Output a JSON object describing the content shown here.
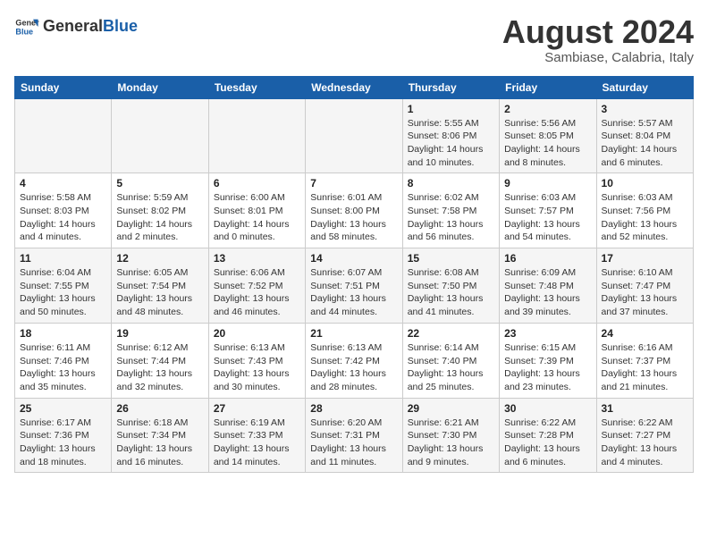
{
  "header": {
    "logo_general": "General",
    "logo_blue": "Blue",
    "month_year": "August 2024",
    "location": "Sambiase, Calabria, Italy"
  },
  "weekdays": [
    "Sunday",
    "Monday",
    "Tuesday",
    "Wednesday",
    "Thursday",
    "Friday",
    "Saturday"
  ],
  "weeks": [
    [
      {
        "day": "",
        "info": ""
      },
      {
        "day": "",
        "info": ""
      },
      {
        "day": "",
        "info": ""
      },
      {
        "day": "",
        "info": ""
      },
      {
        "day": "1",
        "info": "Sunrise: 5:55 AM\nSunset: 8:06 PM\nDaylight: 14 hours\nand 10 minutes."
      },
      {
        "day": "2",
        "info": "Sunrise: 5:56 AM\nSunset: 8:05 PM\nDaylight: 14 hours\nand 8 minutes."
      },
      {
        "day": "3",
        "info": "Sunrise: 5:57 AM\nSunset: 8:04 PM\nDaylight: 14 hours\nand 6 minutes."
      }
    ],
    [
      {
        "day": "4",
        "info": "Sunrise: 5:58 AM\nSunset: 8:03 PM\nDaylight: 14 hours\nand 4 minutes."
      },
      {
        "day": "5",
        "info": "Sunrise: 5:59 AM\nSunset: 8:02 PM\nDaylight: 14 hours\nand 2 minutes."
      },
      {
        "day": "6",
        "info": "Sunrise: 6:00 AM\nSunset: 8:01 PM\nDaylight: 14 hours\nand 0 minutes."
      },
      {
        "day": "7",
        "info": "Sunrise: 6:01 AM\nSunset: 8:00 PM\nDaylight: 13 hours\nand 58 minutes."
      },
      {
        "day": "8",
        "info": "Sunrise: 6:02 AM\nSunset: 7:58 PM\nDaylight: 13 hours\nand 56 minutes."
      },
      {
        "day": "9",
        "info": "Sunrise: 6:03 AM\nSunset: 7:57 PM\nDaylight: 13 hours\nand 54 minutes."
      },
      {
        "day": "10",
        "info": "Sunrise: 6:03 AM\nSunset: 7:56 PM\nDaylight: 13 hours\nand 52 minutes."
      }
    ],
    [
      {
        "day": "11",
        "info": "Sunrise: 6:04 AM\nSunset: 7:55 PM\nDaylight: 13 hours\nand 50 minutes."
      },
      {
        "day": "12",
        "info": "Sunrise: 6:05 AM\nSunset: 7:54 PM\nDaylight: 13 hours\nand 48 minutes."
      },
      {
        "day": "13",
        "info": "Sunrise: 6:06 AM\nSunset: 7:52 PM\nDaylight: 13 hours\nand 46 minutes."
      },
      {
        "day": "14",
        "info": "Sunrise: 6:07 AM\nSunset: 7:51 PM\nDaylight: 13 hours\nand 44 minutes."
      },
      {
        "day": "15",
        "info": "Sunrise: 6:08 AM\nSunset: 7:50 PM\nDaylight: 13 hours\nand 41 minutes."
      },
      {
        "day": "16",
        "info": "Sunrise: 6:09 AM\nSunset: 7:48 PM\nDaylight: 13 hours\nand 39 minutes."
      },
      {
        "day": "17",
        "info": "Sunrise: 6:10 AM\nSunset: 7:47 PM\nDaylight: 13 hours\nand 37 minutes."
      }
    ],
    [
      {
        "day": "18",
        "info": "Sunrise: 6:11 AM\nSunset: 7:46 PM\nDaylight: 13 hours\nand 35 minutes."
      },
      {
        "day": "19",
        "info": "Sunrise: 6:12 AM\nSunset: 7:44 PM\nDaylight: 13 hours\nand 32 minutes."
      },
      {
        "day": "20",
        "info": "Sunrise: 6:13 AM\nSunset: 7:43 PM\nDaylight: 13 hours\nand 30 minutes."
      },
      {
        "day": "21",
        "info": "Sunrise: 6:13 AM\nSunset: 7:42 PM\nDaylight: 13 hours\nand 28 minutes."
      },
      {
        "day": "22",
        "info": "Sunrise: 6:14 AM\nSunset: 7:40 PM\nDaylight: 13 hours\nand 25 minutes."
      },
      {
        "day": "23",
        "info": "Sunrise: 6:15 AM\nSunset: 7:39 PM\nDaylight: 13 hours\nand 23 minutes."
      },
      {
        "day": "24",
        "info": "Sunrise: 6:16 AM\nSunset: 7:37 PM\nDaylight: 13 hours\nand 21 minutes."
      }
    ],
    [
      {
        "day": "25",
        "info": "Sunrise: 6:17 AM\nSunset: 7:36 PM\nDaylight: 13 hours\nand 18 minutes."
      },
      {
        "day": "26",
        "info": "Sunrise: 6:18 AM\nSunset: 7:34 PM\nDaylight: 13 hours\nand 16 minutes."
      },
      {
        "day": "27",
        "info": "Sunrise: 6:19 AM\nSunset: 7:33 PM\nDaylight: 13 hours\nand 14 minutes."
      },
      {
        "day": "28",
        "info": "Sunrise: 6:20 AM\nSunset: 7:31 PM\nDaylight: 13 hours\nand 11 minutes."
      },
      {
        "day": "29",
        "info": "Sunrise: 6:21 AM\nSunset: 7:30 PM\nDaylight: 13 hours\nand 9 minutes."
      },
      {
        "day": "30",
        "info": "Sunrise: 6:22 AM\nSunset: 7:28 PM\nDaylight: 13 hours\nand 6 minutes."
      },
      {
        "day": "31",
        "info": "Sunrise: 6:22 AM\nSunset: 7:27 PM\nDaylight: 13 hours\nand 4 minutes."
      }
    ]
  ]
}
